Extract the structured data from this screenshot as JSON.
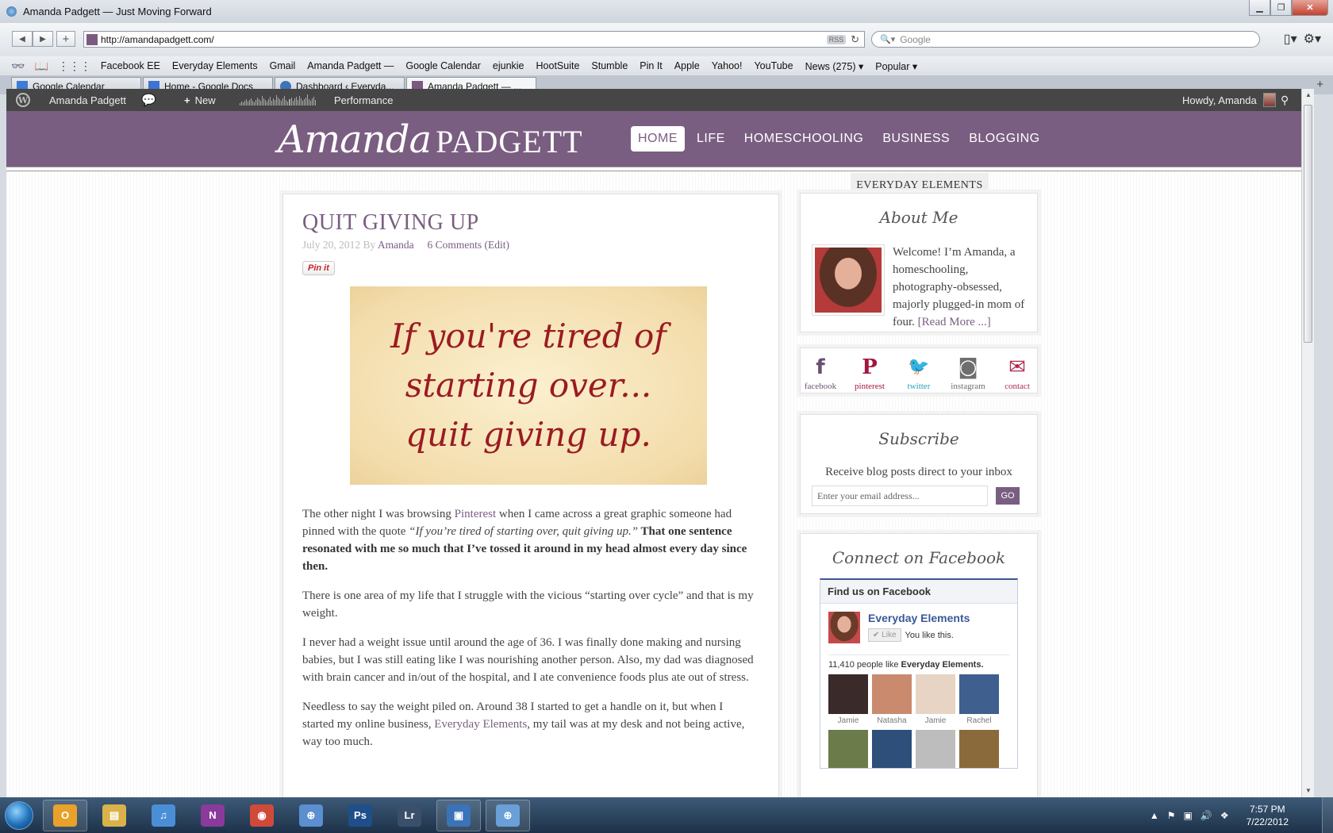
{
  "window": {
    "title": "Amanda Padgett — Just Moving Forward",
    "url": "http://amandapadgett.com/",
    "rss_label": "RSS",
    "search_placeholder": "Google"
  },
  "bookmarks": [
    "Facebook EE",
    "Everyday Elements",
    "Gmail",
    "Amanda Padgett —",
    "Google Calendar",
    "ejunkie",
    "HootSuite",
    "Stumble",
    "Pin It",
    "Apple",
    "Yahoo!",
    "YouTube",
    "News (275) ▾",
    "Popular ▾"
  ],
  "tabs": [
    {
      "label": "Google Calendar",
      "icon": "calendar-icon",
      "color": "#3d7bd9"
    },
    {
      "label": "Home - Google Docs",
      "icon": "docs-icon",
      "color": "#3e73d1"
    },
    {
      "label": "Dashboard ‹ Everyda...",
      "icon": "wordpress-icon",
      "color": "#3c74b8"
    },
    {
      "label": "Amanda Padgett — ...",
      "icon": "site-icon",
      "color": "#7b5a80",
      "active": true
    }
  ],
  "adminbar": {
    "site_name": "Amanda Padgett",
    "new_label": "New",
    "performance_label": "Performance",
    "howdy": "Howdy, Amanda"
  },
  "header": {
    "logo_script": "Amanda",
    "logo_caps": "PADGETT",
    "nav": [
      "HOME",
      "LIFE",
      "HOMESCHOOLING",
      "BUSINESS",
      "BLOGGING"
    ],
    "accent": "#7a5e81"
  },
  "post": {
    "title": "QUIT GIVING UP",
    "date": "July 20, 2012",
    "by": "By",
    "author": "Amanda",
    "comments": "6 Comments",
    "edit": "(Edit)",
    "pin_label": "Pin it",
    "quote_lines": [
      "If you're tired of",
      "starting over...",
      "quit giving up."
    ],
    "p1": {
      "a": "The other night I was browsing ",
      "link": "Pinterest",
      "b": " when I came across a great graphic someone had pinned with the quote ",
      "quote": "“If you’re tired of starting over, quit giving up.”",
      "bold": " That one sentence resonated with me so much that I’ve tossed it around in my head almost every day since then."
    },
    "p2": "There is one area of my life that I struggle with the vicious “starting over cycle” and that is my weight.",
    "p3": "I never had a weight issue until around the age of 36. I was finally done making and nursing babies, but I was still eating like I was nourishing another person. Also, my dad was diagnosed with brain cancer and in/out of the hospital, and I ate convenience foods plus ate out of stress.",
    "p4": {
      "a": "Needless to say the weight piled on. Around 38 I started to get a handle on it, but when I started my online business, ",
      "link": "Everyday Elements",
      "b": ", my tail was at my desk and not being active, way too much."
    }
  },
  "sidebar": {
    "tab_label": "EVERYDAY ELEMENTS",
    "about": {
      "title": "About Me",
      "text": "Welcome! I’m Amanda, a homeschooling, photography-obsessed, majorly plugged-in mom of four. ",
      "read_more": "[Read More ...]"
    },
    "social": [
      {
        "glyph": "f",
        "label": "facebook",
        "icon": "facebook-icon",
        "color": "#6b4f72"
      },
      {
        "glyph": "P",
        "label": "pinterest",
        "icon": "pinterest-icon",
        "color": "#a3163d"
      },
      {
        "glyph": "🐦",
        "label": "twitter",
        "icon": "twitter-icon",
        "color": "#1fa3b8"
      },
      {
        "glyph": "◙",
        "label": "instagram",
        "icon": "instagram-icon",
        "color": "#6e6e6e"
      },
      {
        "glyph": "✉",
        "label": "contact",
        "icon": "mail-icon",
        "color": "#b0284e"
      }
    ],
    "subscribe": {
      "title": "Subscribe",
      "text": "Receive blog posts direct to your inbox",
      "placeholder": "Enter your email address...",
      "go": "GO"
    },
    "facebook": {
      "title": "Connect on Facebook",
      "box_head": "Find us on Facebook",
      "page_name": "Everyday Elements",
      "like_label": "✔ Like",
      "you_like": "You like this.",
      "count_text": "11,410 people like ",
      "count_bold": "Everyday Elements.",
      "faces": [
        {
          "name": "Jamie",
          "color": "#3a2a2a"
        },
        {
          "name": "Natasha",
          "color": "#c98a6e"
        },
        {
          "name": "Jamie",
          "color": "#e8d4c4"
        },
        {
          "name": "Rachel",
          "color": "#3f5f8f"
        },
        {
          "name": "",
          "color": "#6b7b4a"
        },
        {
          "name": "",
          "color": "#2d4f7a"
        },
        {
          "name": "",
          "color": "#bdbdbd"
        },
        {
          "name": "",
          "color": "#8a6a3a"
        }
      ]
    }
  },
  "taskbar": {
    "apps": [
      {
        "label": "O",
        "icon": "outlook-icon",
        "color": "#e8a22a",
        "pinned": true
      },
      {
        "label": "▤",
        "icon": "explorer-icon",
        "color": "#d9b24a",
        "pinned": false
      },
      {
        "label": "♫",
        "icon": "itunes-icon",
        "color": "#4a8fd6",
        "pinned": false
      },
      {
        "label": "N",
        "icon": "onenote-icon",
        "color": "#8a3a9a",
        "pinned": false
      },
      {
        "label": "◉",
        "icon": "chrome-icon",
        "color": "#d04a3a",
        "pinned": false
      },
      {
        "label": "⊕",
        "icon": "safari-compass-icon",
        "color": "#5b8fd0",
        "pinned": false
      },
      {
        "label": "Ps",
        "icon": "photoshop-icon",
        "color": "#1f4f8a",
        "pinned": false
      },
      {
        "label": "Lr",
        "icon": "lightroom-icon",
        "color": "#3a4f6a",
        "pinned": false
      },
      {
        "label": "▣",
        "icon": "window-app-icon",
        "color": "#3a73b8",
        "pinned": true
      },
      {
        "label": "⊕",
        "icon": "safari-icon",
        "color": "#6a9fd8",
        "pinned": true
      }
    ],
    "time": "7:57 PM",
    "date": "7/22/2012"
  }
}
